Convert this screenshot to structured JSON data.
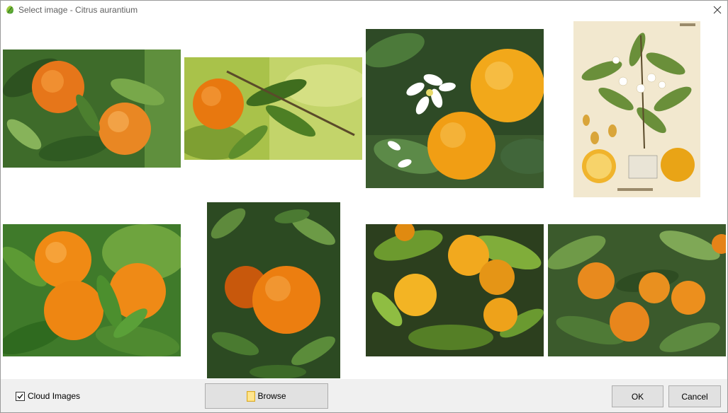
{
  "window": {
    "title": "Select image - Citrus aurantium"
  },
  "images": [
    {
      "name": "image-1",
      "subject": "two oranges on tree among leaves"
    },
    {
      "name": "image-2",
      "subject": "single orange on branch, blurred background"
    },
    {
      "name": "image-3",
      "subject": "white orange blossoms with ripe oranges"
    },
    {
      "name": "image-4",
      "subject": "botanical illustration of Citrus vulgaris"
    },
    {
      "name": "image-5",
      "subject": "cluster of three oranges with leaves"
    },
    {
      "name": "image-6",
      "subject": "orange hanging among dark leaves"
    },
    {
      "name": "image-7",
      "subject": "several yellow-orange fruits in sunlight"
    },
    {
      "name": "image-8",
      "subject": "bumpy bitter oranges on tree"
    }
  ],
  "footer": {
    "cloud_images_label": "Cloud Images",
    "cloud_images_checked": true,
    "browse_label": "Browse",
    "ok_label": "OK",
    "cancel_label": "Cancel"
  },
  "colors": {
    "footer_bg": "#f0f0f0",
    "button_bg": "#e1e1e1",
    "button_border": "#adadad",
    "title_text": "#606060"
  }
}
